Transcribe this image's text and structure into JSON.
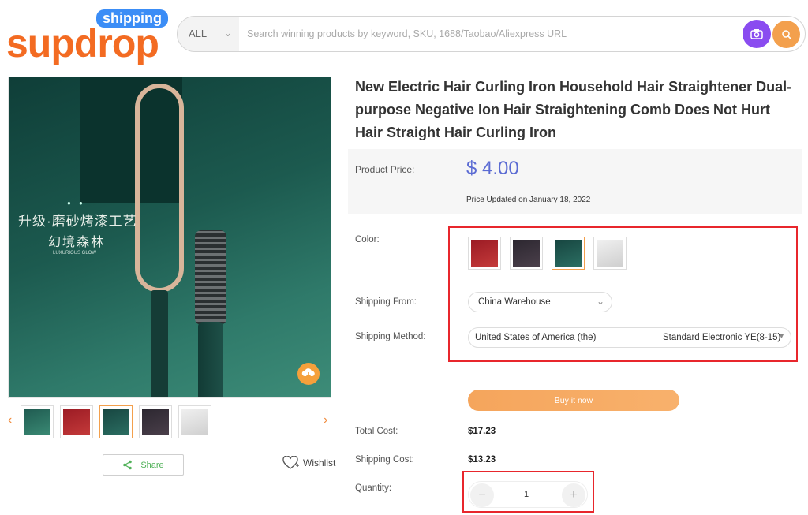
{
  "header": {
    "logo_word": "supdrop",
    "logo_badge": "shipping",
    "search_category": "ALL",
    "search_placeholder": "Search winning products by keyword, SKU, 1688/Taobao/Aliexpress URL",
    "camera_icon": "camera-icon",
    "search_icon": "search-icon",
    "colors": {
      "brand": "#f36b22",
      "badge": "#3b8df6",
      "camera": "#8a4cf0",
      "search": "#f3a04d"
    }
  },
  "gallery": {
    "overlay_text_1": "升级·磨砂烤漆工艺",
    "overlay_text_2": "幻境森林",
    "overlay_text_3": "LUXURIOUS GLOW",
    "thumbnails": [
      "#1f5a50",
      "#9b1b24",
      "#174540",
      "#2c2730",
      "#e4e4e4"
    ],
    "selected_thumbnail": 2,
    "share_label": "Share",
    "wishlist_label": "Wishlist"
  },
  "product": {
    "title": "New Electric Hair Curling Iron Household Hair Straightener Dual-purpose Negative Ion Hair Straightening Comb Does Not Hurt Hair Straight Hair Curling Iron",
    "price_label": "Product Price:",
    "price": "$ 4.00",
    "price_updated": "Price Updated on January 18, 2022",
    "color_label": "Color:",
    "color_swatches": [
      "#9b1b24",
      "#2c2730",
      "#174540",
      "#e4e4e4"
    ],
    "selected_color": 2,
    "shipping_from_label": "Shipping From:",
    "shipping_from": "China Warehouse",
    "shipping_method_label": "Shipping Method:",
    "shipping_country": "United States of America (the)",
    "shipping_method": "Standard Electronic YE(8-15)",
    "buy_label": "Buy it now",
    "total_cost_label": "Total Cost:",
    "total_cost": "$17.23",
    "shipping_cost_label": "Shipping Cost:",
    "shipping_cost": "$13.23",
    "quantity_label": "Quantity:",
    "quantity": "1"
  }
}
